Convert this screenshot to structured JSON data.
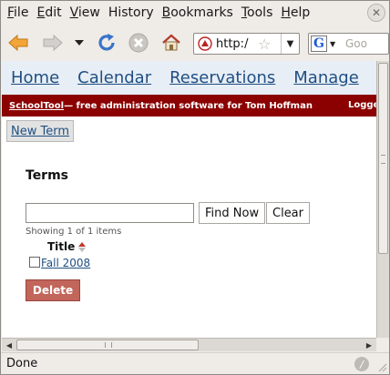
{
  "menubar": {
    "items": [
      {
        "label": "File",
        "accel": "F",
        "rest": "ile"
      },
      {
        "label": "Edit",
        "accel": "E",
        "rest": "dit"
      },
      {
        "label": "View",
        "accel": "V",
        "rest": "iew"
      },
      {
        "label": "History",
        "accel": "H",
        "rest": "istory",
        "pre": "Hi"
      },
      {
        "label": "Bookmarks",
        "accel": "B",
        "rest": "ookmarks"
      },
      {
        "label": "Tools",
        "accel": "T",
        "rest": "ools"
      },
      {
        "label": "Help",
        "accel": "H",
        "rest": "elp"
      }
    ]
  },
  "toolbar": {
    "url_text": "http:/",
    "search_placeholder": "Goo"
  },
  "nav": {
    "links": [
      "Home",
      "Calendar",
      "Reservations",
      "Manage"
    ]
  },
  "banner": {
    "app_link": "SchoolTool",
    "tagline": " — free administration software for Tom Hoffman",
    "logged": "Logge"
  },
  "actions": {
    "new_term": "New Term"
  },
  "terms": {
    "heading": "Terms",
    "find_label": "Find Now",
    "clear_label": "Clear",
    "showing": "Showing 1 of 1 items",
    "column_title": "Title",
    "rows": [
      {
        "title": "Fall 2008"
      }
    ],
    "delete_label": "Delete"
  },
  "status": {
    "text": "Done"
  },
  "colors": {
    "banner": "#8b0000",
    "nav_bg": "#e8eef6",
    "link": "#1f4f82",
    "delete_button": "#c2655a"
  },
  "icons": [
    "back-arrow-icon",
    "forward-arrow-icon",
    "history-dropdown-icon",
    "reload-icon",
    "stop-icon",
    "home-icon",
    "site-favicon-icon",
    "bookmark-star-icon",
    "url-dropdown-icon",
    "google-search-icon",
    "sort-icon",
    "close-window-icon",
    "status-icon"
  ]
}
